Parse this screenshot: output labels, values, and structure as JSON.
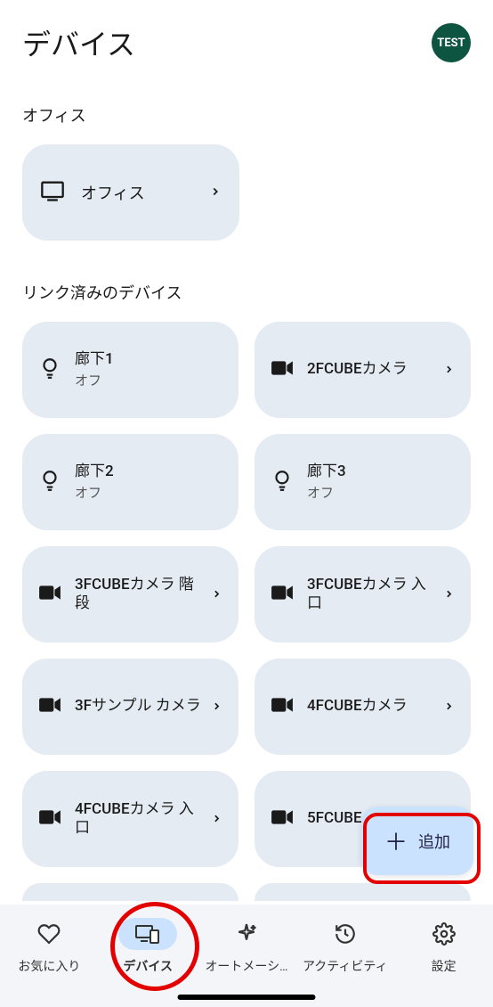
{
  "header": {
    "title": "デバイス",
    "avatar_text": "TEST"
  },
  "sections": {
    "office_title": "オフィス",
    "office_card": {
      "label": "オフィス"
    },
    "linked_title": "リンク済みのデバイス"
  },
  "devices": [
    {
      "name": "廊下1",
      "status": "オフ",
      "icon": "bulb",
      "chevron": false
    },
    {
      "name": "2FCUBEカメラ",
      "status": "",
      "icon": "camera",
      "chevron": true
    },
    {
      "name": "廊下2",
      "status": "オフ",
      "icon": "bulb",
      "chevron": false
    },
    {
      "name": "廊下3",
      "status": "オフ",
      "icon": "bulb",
      "chevron": false
    },
    {
      "name": "3FCUBEカメラ 階段",
      "status": "",
      "icon": "camera",
      "chevron": true
    },
    {
      "name": "3FCUBEカメラ 入口",
      "status": "",
      "icon": "camera",
      "chevron": true
    },
    {
      "name": "3Fサンプル カメラ",
      "status": "",
      "icon": "camera",
      "chevron": true
    },
    {
      "name": "4FCUBEカメラ",
      "status": "",
      "icon": "camera",
      "chevron": true
    },
    {
      "name": "4FCUBEカメラ 入口",
      "status": "",
      "icon": "camera",
      "chevron": true
    },
    {
      "name": "5FCUBE",
      "status": "",
      "icon": "camera",
      "chevron": true
    }
  ],
  "fab": {
    "label": "追加"
  },
  "nav": {
    "items": [
      {
        "label": "お気に入り",
        "icon": "heart",
        "active": false
      },
      {
        "label": "デバイス",
        "icon": "devices",
        "active": true
      },
      {
        "label": "オートメーシ…",
        "icon": "sparkle",
        "active": false
      },
      {
        "label": "アクティビティ",
        "icon": "history",
        "active": false
      },
      {
        "label": "設定",
        "icon": "gear",
        "active": false
      }
    ]
  }
}
